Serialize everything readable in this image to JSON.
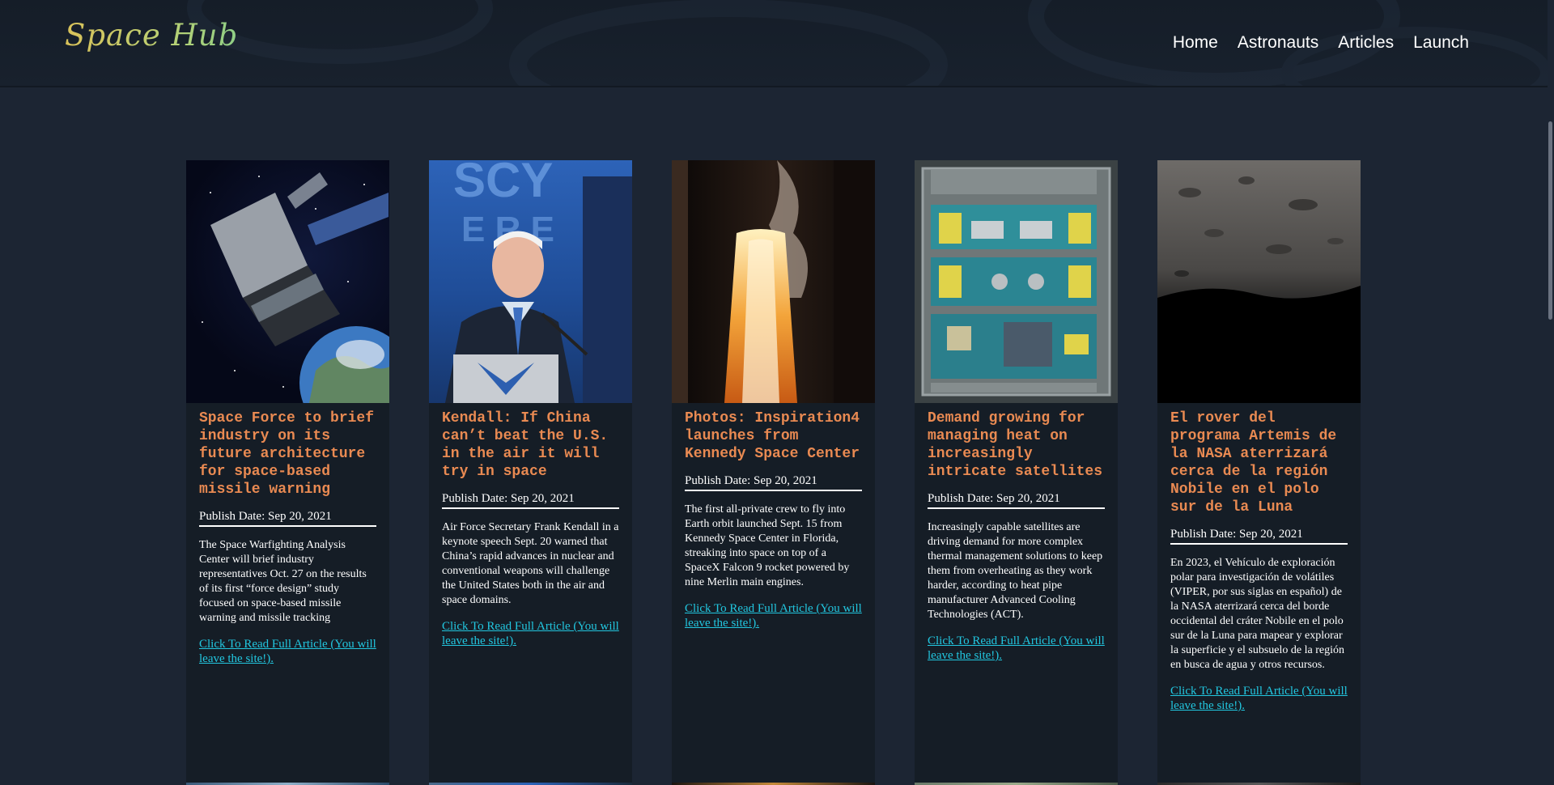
{
  "header": {
    "logo": "Space Hub",
    "nav": [
      "Home",
      "Astronauts",
      "Articles",
      "Launch"
    ]
  },
  "articles": [
    {
      "title": "Space Force to brief industry on its future architecture for space-based missile warning",
      "date": "Publish Date: Sep 20, 2021",
      "description": "The Space Warfighting Analysis Center will brief industry representatives Oct. 27 on the results of its first “force design” study focused on space-based missile warning and missile tracking",
      "link": "Click To Read Full Article (You will leave the site!).",
      "image": "satellite-orbiting-earth"
    },
    {
      "title": "Kendall: If China can’t beat the U.S. in the air it will try in space",
      "date": "Publish Date: Sep 20, 2021",
      "description": "Air Force Secretary Frank Kendall in a keynote speech Sept. 20 warned that China’s rapid advances in nuclear and conventional weapons will challenge the United States both in the air and space domains.",
      "link": "Click To Read Full Article (You will leave the site!).",
      "image": "speaker-at-podium"
    },
    {
      "title": "Photos: Inspiration4 launches from Kennedy Space Center",
      "date": "Publish Date: Sep 20, 2021",
      "description": "The first all-private crew to fly into Earth orbit launched Sept. 15 from Kennedy Space Center in Florida, streaking into space on top of a SpaceX Falcon 9 rocket powered by nine Merlin main engines.",
      "link": "Click To Read Full Article (You will leave the site!).",
      "image": "rocket-launch-exhaust"
    },
    {
      "title": "Demand growing for managing heat on increasingly intricate satellites",
      "date": "Publish Date: Sep 20, 2021",
      "description": "Increasingly capable satellites are driving demand for more complex thermal management solutions to keep them from overheating as they work harder, according to heat pipe manufacturer Advanced Cooling Technologies (ACT).",
      "link": "Click To Read Full Article (You will leave the site!).",
      "image": "circuit-board"
    },
    {
      "title": "El rover del programa Artemis de la NASA aterrizará cerca de la región Nobile en el polo sur de la Luna",
      "date": "Publish Date: Sep 20, 2021",
      "description": "En 2023, el Vehículo de exploración polar para investigación de volátiles (VIPER, por sus siglas en español) de la NASA aterrizará cerca del borde occidental del cráter Nobile en el polo sur de la Luna para mapear y explorar la superficie y el subsuelo de la región en busca de agua y otros recursos.",
      "link": "Click To Read Full Article (You will leave the site!).",
      "image": "lunar-surface"
    }
  ],
  "colors": {
    "title": "#e98a52",
    "link": "#22c7e0",
    "card_bg": "#151d26",
    "page_bg": "#1c2533"
  }
}
